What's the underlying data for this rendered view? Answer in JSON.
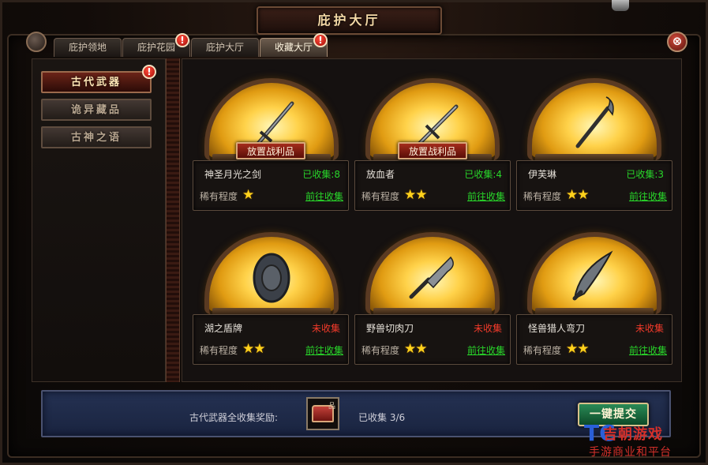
{
  "window": {
    "title": "庇护大厅",
    "close_label": "⊗"
  },
  "tabs": [
    {
      "label": "庇护领地",
      "active": false,
      "badge": false
    },
    {
      "label": "庇护花园",
      "active": false,
      "badge": true
    },
    {
      "label": "庇护大厅",
      "active": false,
      "badge": false
    },
    {
      "label": "收藏大厅",
      "active": true,
      "badge": true
    }
  ],
  "badge_glyph": "!",
  "categories": [
    {
      "label": "古代武器",
      "active": true,
      "badge": true
    },
    {
      "label": "诡异藏品",
      "active": false,
      "badge": false
    },
    {
      "label": "古神之语",
      "active": false,
      "badge": false
    }
  ],
  "items": [
    {
      "name": "神圣月光之剑",
      "status": "已收集:8",
      "collected": true,
      "rarity_label": "稀有程度",
      "stars": "★",
      "star_count": 1,
      "goto": "前往收集",
      "place_label": "放置战利品",
      "show_place": true,
      "weapon_icon": "sword-icon"
    },
    {
      "name": "放血者",
      "status": "已收集:4",
      "collected": true,
      "rarity_label": "稀有程度",
      "stars": "★★",
      "star_count": 2,
      "goto": "前往收集",
      "place_label": "放置战利品",
      "show_place": true,
      "weapon_icon": "sword-icon"
    },
    {
      "name": "伊芙琳",
      "status": "已收集:3",
      "collected": true,
      "rarity_label": "稀有程度",
      "stars": "★★",
      "star_count": 2,
      "goto": "前往收集",
      "show_place": false,
      "weapon_icon": "scythe-icon"
    },
    {
      "name": "湖之盾牌",
      "status": "未收集",
      "collected": false,
      "rarity_label": "稀有程度",
      "stars": "★★",
      "star_count": 2,
      "goto": "前往收集",
      "show_place": false,
      "weapon_icon": "shield-icon"
    },
    {
      "name": "野兽切肉刀",
      "status": "未收集",
      "collected": false,
      "rarity_label": "稀有程度",
      "stars": "★★",
      "star_count": 2,
      "goto": "前往收集",
      "show_place": false,
      "weapon_icon": "cleaver-icon"
    },
    {
      "name": "怪兽猎人弯刀",
      "status": "未收集",
      "collected": false,
      "rarity_label": "稀有程度",
      "stars": "★★",
      "star_count": 2,
      "goto": "前往收集",
      "show_place": false,
      "weapon_icon": "scimitar-icon"
    }
  ],
  "footer": {
    "reward_label": "古代武器全收集奖励:",
    "chest_tag": "品",
    "collected_text": "已收集  3/6",
    "submit_label": "一键提交"
  },
  "watermark": {
    "logo": "TC",
    "brand": "吉朝游戏",
    "sub": "手游商业和平台"
  },
  "colors": {
    "collected": "#28d62a",
    "not_collected": "#f23a2a",
    "accent_gold": "#ffd21c"
  }
}
